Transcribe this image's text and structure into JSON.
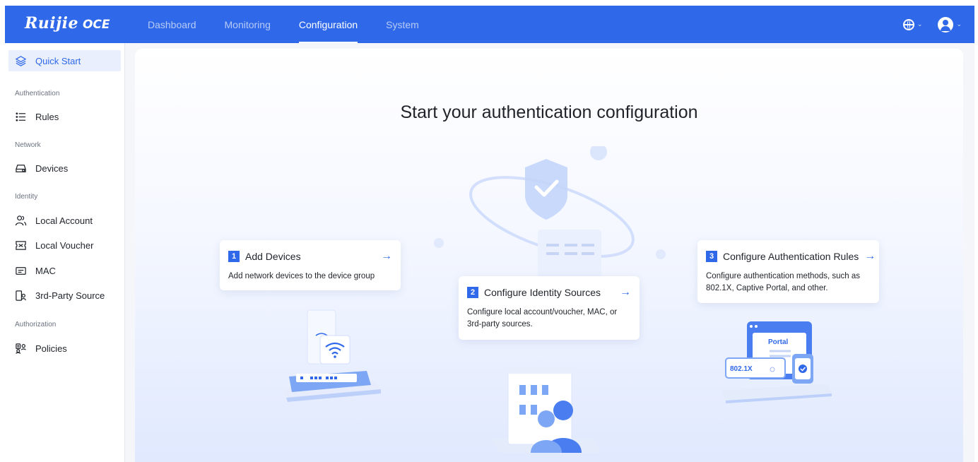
{
  "app": {
    "brand": "Ruijie",
    "product": "OCE"
  },
  "nav": {
    "items": [
      {
        "label": "Dashboard",
        "active": false
      },
      {
        "label": "Monitoring",
        "active": false
      },
      {
        "label": "Configuration",
        "active": true
      },
      {
        "label": "System",
        "active": false
      }
    ],
    "language_icon": "globe-icon",
    "user_icon": "user-avatar-icon"
  },
  "sidebar": {
    "quick_start": "Quick Start",
    "group_authentication": "Authentication",
    "rules": "Rules",
    "group_network": "Network",
    "devices": "Devices",
    "group_identity": "Identity",
    "local_account": "Local Account",
    "local_voucher": "Local Voucher",
    "mac": "MAC",
    "third_party": "3rd-Party Source",
    "group_authorization": "Authorization",
    "policies": "Policies"
  },
  "main": {
    "title": "Start your authentication configuration",
    "steps": [
      {
        "num": "1",
        "title": "Add Devices",
        "desc": "Add network devices to the device group"
      },
      {
        "num": "2",
        "title": "Configure Identity Sources",
        "desc": "Configure local account/voucher, MAC, or 3rd-party sources."
      },
      {
        "num": "3",
        "title": "Configure Authentication Rules",
        "desc": "Configure authentication methods, such as 802.1X, Captive Portal, and other."
      }
    ],
    "illustration_labels": {
      "portal": "Portal",
      "dot1x": "802.1X"
    }
  },
  "colors": {
    "primary": "#2f68e8",
    "sidebar_active_bg": "#e9effd"
  }
}
